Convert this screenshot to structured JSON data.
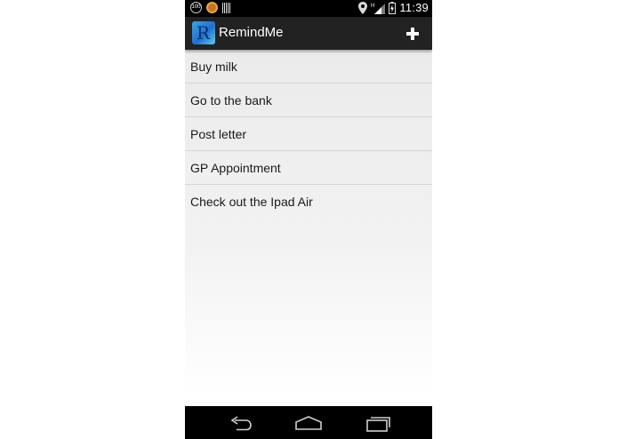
{
  "status_bar": {
    "badge_text": "100",
    "network_label": "H",
    "time": "11:39"
  },
  "action_bar": {
    "app_icon_letter": "R",
    "title": "RemindMe",
    "add_icon": "plus-icon"
  },
  "reminders": [
    {
      "label": "Buy milk"
    },
    {
      "label": "Go to the bank"
    },
    {
      "label": "Post letter"
    },
    {
      "label": "GP Appointment"
    },
    {
      "label": "Check out the Ipad Air"
    }
  ],
  "nav_bar": {
    "icons": [
      "back-icon",
      "home-icon",
      "recents-icon"
    ]
  },
  "colors": {
    "status_bar_bg": "#000000",
    "action_bar_bg": "#222222",
    "list_bg": "#e9e9e9",
    "text": "#1a1a1a"
  }
}
